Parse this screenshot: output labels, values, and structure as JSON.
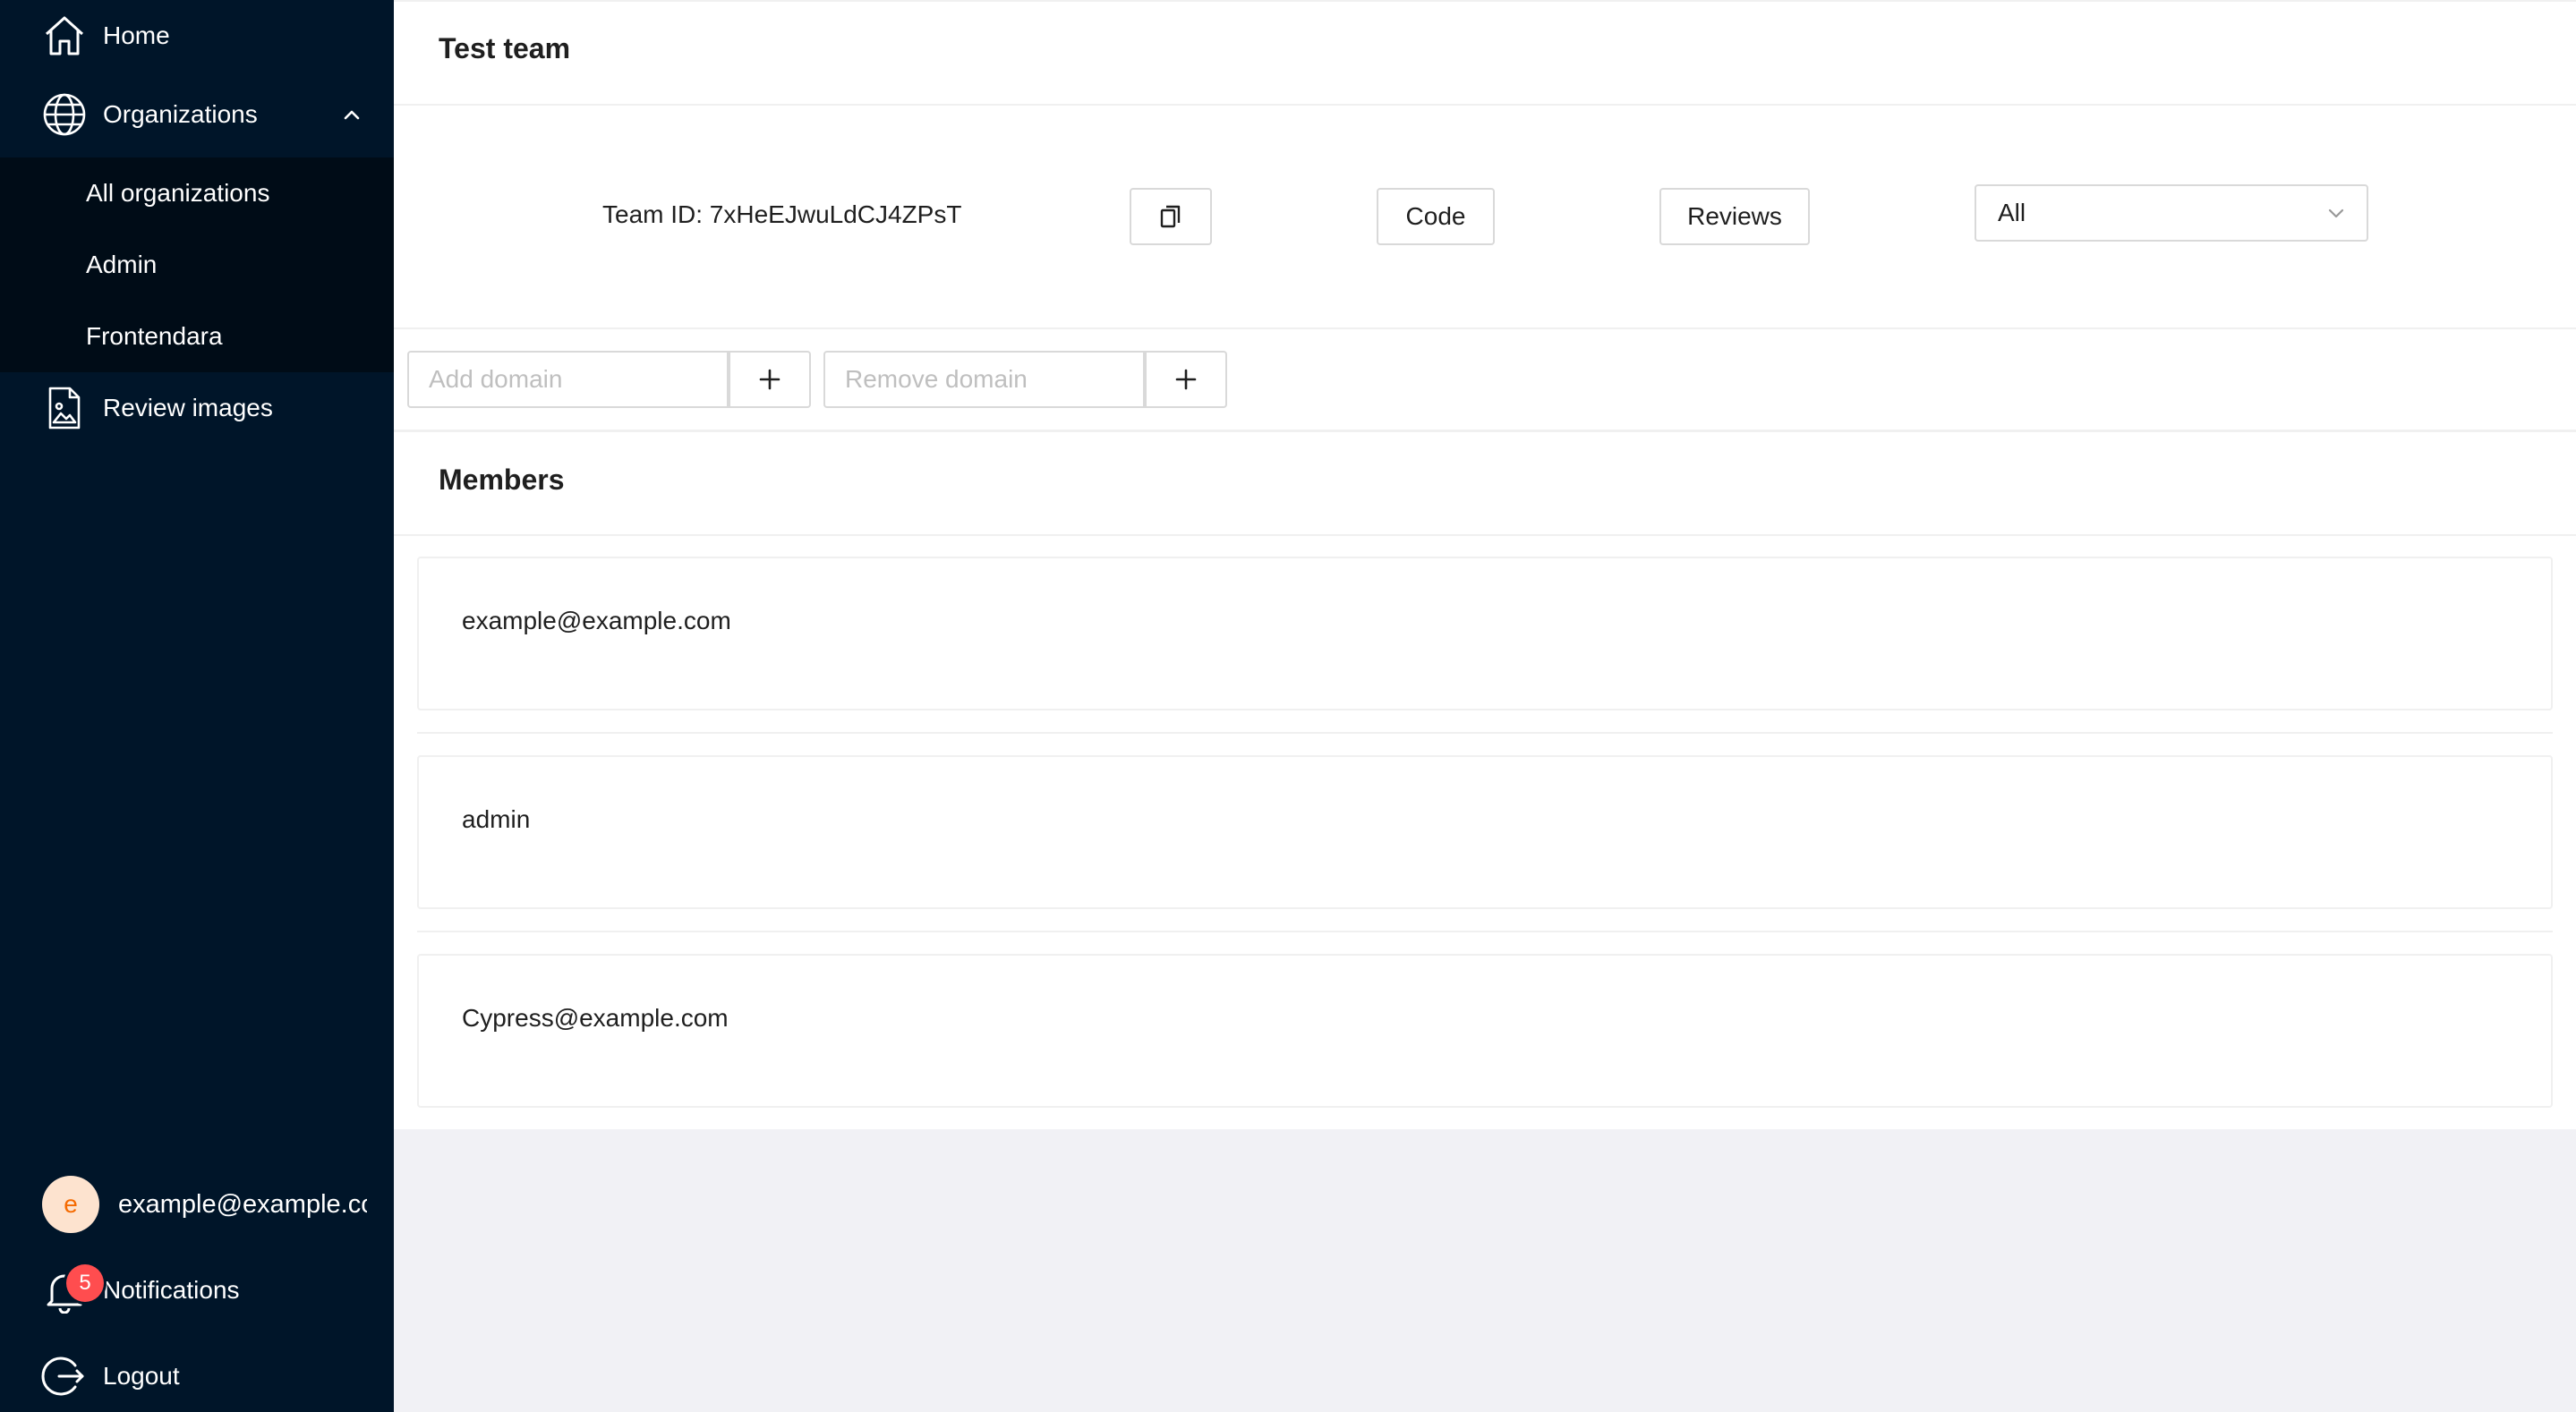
{
  "sidebar": {
    "items": [
      {
        "label": "Home",
        "icon": "home-icon"
      },
      {
        "label": "Organizations",
        "icon": "globe-icon",
        "expanded": true
      },
      {
        "label": "Review images",
        "icon": "file-image-icon"
      }
    ],
    "submenu": [
      {
        "label": "All organizations"
      },
      {
        "label": "Admin"
      },
      {
        "label": "Frontendara"
      }
    ],
    "user": {
      "avatar_letter": "e",
      "email": "example@example.com"
    },
    "notifications": {
      "label": "Notifications",
      "count": "5"
    },
    "logout": {
      "label": "Logout"
    }
  },
  "team": {
    "title": "Test team",
    "id_label": "Team ID: 7xHeEJwuLdCJ4ZPsT",
    "code_button": "Code",
    "reviews_button": "Reviews",
    "filter": {
      "selected": "All"
    }
  },
  "domains": {
    "add_placeholder": "Add domain",
    "remove_placeholder": "Remove domain"
  },
  "members": {
    "title": "Members",
    "list": [
      {
        "email": "example@example.com"
      },
      {
        "email": "admin"
      },
      {
        "email": "Cypress@example.com"
      }
    ]
  },
  "colors": {
    "sidebar_bg": "#001529",
    "submenu_bg": "#000c17",
    "badge": "#ff4d4f",
    "page_bg": "#f1f1f5"
  }
}
